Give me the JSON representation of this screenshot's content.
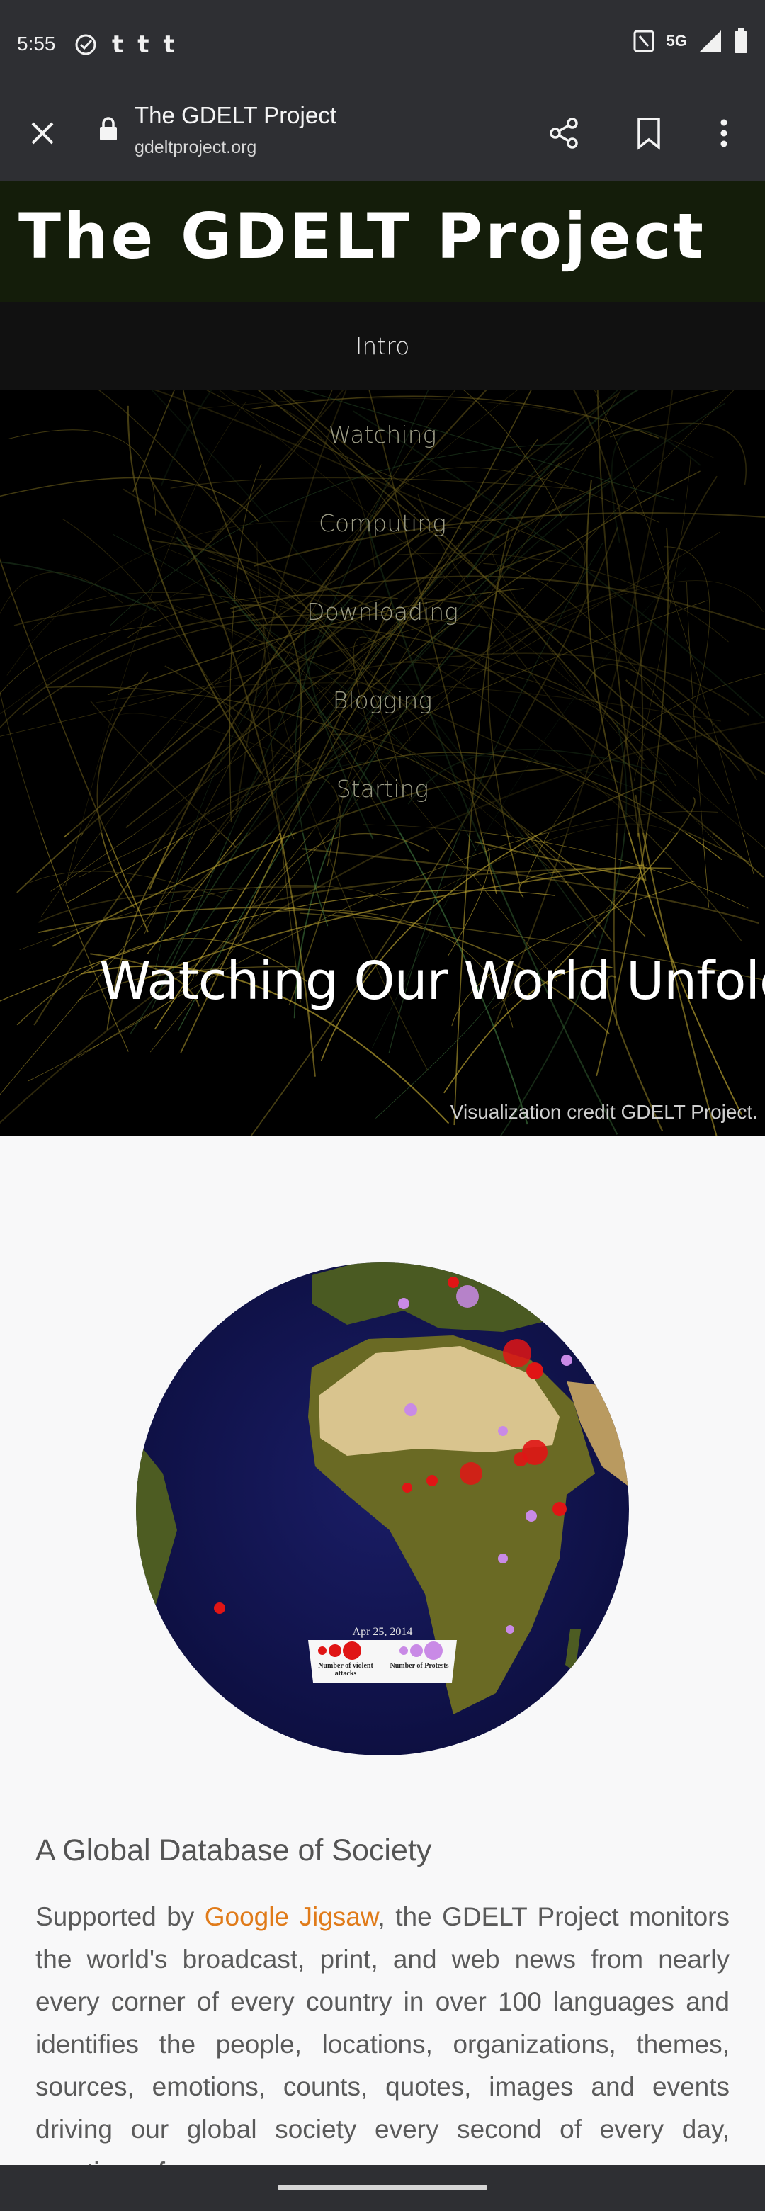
{
  "status_bar": {
    "time": "5:55",
    "left_icons": [
      "check-circle-icon",
      "tumblr-icon",
      "tumblr-icon",
      "tumblr-icon"
    ],
    "network": "5G",
    "right_icons": [
      "nfc-icon",
      "signal-icon",
      "battery-icon"
    ]
  },
  "browser": {
    "page_title": "The GDELT Project",
    "url": "gdeltproject.org"
  },
  "site": {
    "title": "The GDELT Project",
    "nav": [
      "Intro",
      "Watching",
      "Computing",
      "Downloading",
      "Blogging",
      "Starting"
    ],
    "active_nav": "Intro"
  },
  "hero": {
    "heading": "Watching Our World Unfold",
    "credit": "Visualization credit GDELT Project."
  },
  "globe": {
    "date": "Apr 25, 2014",
    "legend_left": "Number of violent attacks",
    "legend_right": "Number of Protests"
  },
  "section": {
    "heading": "A Global Database of Society",
    "text_before_link": "Supported by ",
    "link": "Google Jigsaw",
    "text_after_link": ", the GDELT Project monitors the world's broadcast, print, and web news from nearly every corner of every country in over 100 languages and identifies the people, locations, organizations, themes, sources, emotions, counts, quotes, images and events driving our global society every second of every day, creating a free open"
  },
  "colors": {
    "chrome": "#2e2f33",
    "header_bg": "#141d0a",
    "link": "#e07b1a",
    "body_text": "#5a5a5a"
  }
}
